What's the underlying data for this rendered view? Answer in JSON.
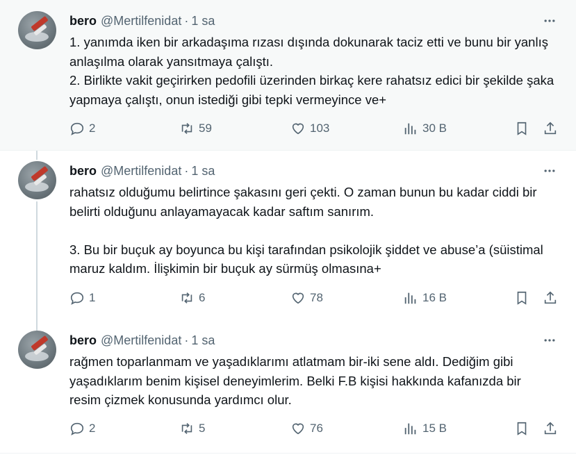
{
  "tweets": [
    {
      "name": "bero",
      "handle": "@Mertilfenidat",
      "separator": "·",
      "time": "1 sa",
      "text": "1. yanımda iken bir arkadaşıma rızası dışında dokunarak taciz etti ve bunu bir yanlış anlaşılma olarak yansıtmaya çalıştı.\n2. Birlikte vakit geçirirken pedofili üzerinden birkaç kere rahatsız edici bir şekilde şaka yapmaya çalıştı, onun istediği gibi tepki vermeyince ve+",
      "replies": "2",
      "retweets": "59",
      "likes": "103",
      "views": "30 B"
    },
    {
      "name": "bero",
      "handle": "@Mertilfenidat",
      "separator": "·",
      "time": "1 sa",
      "text": "rahatsız olduğumu belirtince şakasını geri çekti. O zaman bunun bu kadar ciddi bir belirti olduğunu anlayamayacak kadar saftım sanırım.\n\n3. Bu bir buçuk ay boyunca bu kişi tarafından psikolojik şiddet ve abuse’a (süistimal maruz kaldım. İlişkimin bir buçuk ay sürmüş olmasına+",
      "replies": "1",
      "retweets": "6",
      "likes": "78",
      "views": "16 B"
    },
    {
      "name": "bero",
      "handle": "@Mertilfenidat",
      "separator": "·",
      "time": "1 sa",
      "text": "rağmen toparlanmam ve yaşadıklarımı atlatmam bir-iki sene aldı. Dediğim gibi yaşadıklarım benim kişisel deneyimlerim. Belki F.B kişisi hakkında kafanızda bir resim çizmek konusunda yardımcı olur.",
      "replies": "2",
      "retweets": "5",
      "likes": "76",
      "views": "15 B"
    }
  ],
  "icons": {
    "reply": "reply-icon",
    "retweet": "retweet-icon",
    "like": "heart-icon",
    "views": "views-icon",
    "bookmark": "bookmark-icon",
    "share": "share-icon",
    "more": "more-icon"
  },
  "colors": {
    "text": "#0f1419",
    "secondary": "#536471",
    "highlight_bg": "#f7f9f9",
    "thread_line": "#cfd9de"
  }
}
